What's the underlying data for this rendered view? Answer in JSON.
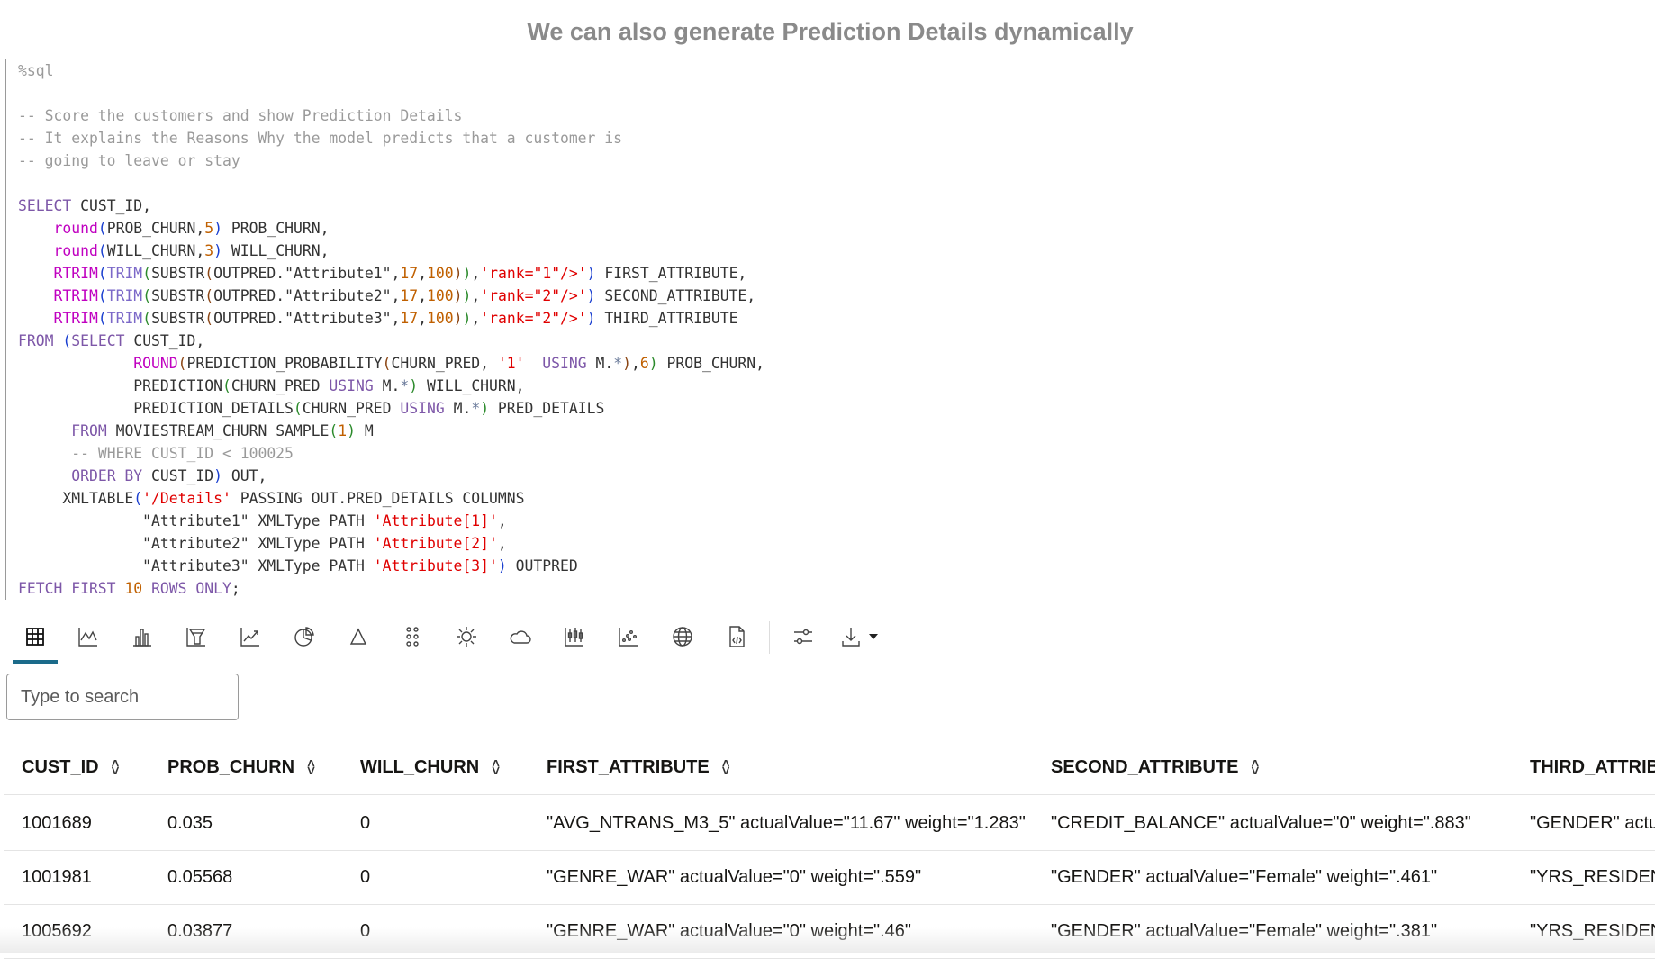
{
  "title": "We can also generate Prediction Details dynamically",
  "code": {
    "lines": [
      [
        [
          "cm",
          "%sql"
        ]
      ],
      [],
      [
        [
          "cm",
          "-- Score the customers and show Prediction Details"
        ]
      ],
      [
        [
          "cm",
          "-- It explains the Reasons Why the model predicts that a customer is"
        ]
      ],
      [
        [
          "cm",
          "-- going to leave or stay"
        ]
      ],
      [],
      [
        [
          "kw",
          "SELECT"
        ],
        [
          "t",
          " CUST_ID,"
        ]
      ],
      [
        [
          "t",
          "    "
        ],
        [
          "fn",
          "round"
        ],
        [
          "p1",
          "("
        ],
        [
          "t",
          "PROB_CHURN,"
        ],
        [
          "nu",
          "5"
        ],
        [
          "p1",
          ")"
        ],
        [
          "t",
          " PROB_CHURN,"
        ]
      ],
      [
        [
          "t",
          "    "
        ],
        [
          "fn",
          "round"
        ],
        [
          "p1",
          "("
        ],
        [
          "t",
          "WILL_CHURN,"
        ],
        [
          "nu",
          "3"
        ],
        [
          "p1",
          ")"
        ],
        [
          "t",
          " WILL_CHURN,"
        ]
      ],
      [
        [
          "t",
          "    "
        ],
        [
          "fn",
          "RTRIM"
        ],
        [
          "p1",
          "("
        ],
        [
          "fn2",
          "TRIM"
        ],
        [
          "p2",
          "("
        ],
        [
          "t",
          "SUBSTR"
        ],
        [
          "p3",
          "("
        ],
        [
          "t",
          "OUTPRED.\"Attribute1\","
        ],
        [
          "nu",
          "17"
        ],
        [
          "t",
          ","
        ],
        [
          "nu",
          "100"
        ],
        [
          "p3",
          ")"
        ],
        [
          "p2",
          ")"
        ],
        [
          "t",
          ","
        ],
        [
          "st",
          "'rank=\"1\"/>'"
        ],
        [
          "p1",
          ")"
        ],
        [
          "t",
          " FIRST_ATTRIBUTE,"
        ]
      ],
      [
        [
          "t",
          "    "
        ],
        [
          "fn",
          "RTRIM"
        ],
        [
          "p1",
          "("
        ],
        [
          "fn2",
          "TRIM"
        ],
        [
          "p2",
          "("
        ],
        [
          "t",
          "SUBSTR"
        ],
        [
          "p3",
          "("
        ],
        [
          "t",
          "OUTPRED.\"Attribute2\","
        ],
        [
          "nu",
          "17"
        ],
        [
          "t",
          ","
        ],
        [
          "nu",
          "100"
        ],
        [
          "p3",
          ")"
        ],
        [
          "p2",
          ")"
        ],
        [
          "t",
          ","
        ],
        [
          "st",
          "'rank=\"2\"/>'"
        ],
        [
          "p1",
          ")"
        ],
        [
          "t",
          " SECOND_ATTRIBUTE,"
        ]
      ],
      [
        [
          "t",
          "    "
        ],
        [
          "fn",
          "RTRIM"
        ],
        [
          "p1",
          "("
        ],
        [
          "fn2",
          "TRIM"
        ],
        [
          "p2",
          "("
        ],
        [
          "t",
          "SUBSTR"
        ],
        [
          "p3",
          "("
        ],
        [
          "t",
          "OUTPRED.\"Attribute3\","
        ],
        [
          "nu",
          "17"
        ],
        [
          "t",
          ","
        ],
        [
          "nu",
          "100"
        ],
        [
          "p3",
          ")"
        ],
        [
          "p2",
          ")"
        ],
        [
          "t",
          ","
        ],
        [
          "st",
          "'rank=\"2\"/>'"
        ],
        [
          "p1",
          ")"
        ],
        [
          "t",
          " THIRD_ATTRIBUTE"
        ]
      ],
      [
        [
          "kw",
          "FROM"
        ],
        [
          "t",
          " "
        ],
        [
          "p1",
          "("
        ],
        [
          "kw",
          "SELECT"
        ],
        [
          "t",
          " CUST_ID,"
        ]
      ],
      [
        [
          "t",
          "             "
        ],
        [
          "fn",
          "ROUND"
        ],
        [
          "p3",
          "("
        ],
        [
          "t",
          "PREDICTION_PROBABILITY"
        ],
        [
          "p3",
          "("
        ],
        [
          "t",
          "CHURN_PRED, "
        ],
        [
          "st",
          "'1'"
        ],
        [
          "t",
          "  "
        ],
        [
          "kw",
          "USING"
        ],
        [
          "t",
          " M."
        ],
        [
          "op",
          "*"
        ],
        [
          "p3",
          ")"
        ],
        [
          "t",
          ","
        ],
        [
          "nu",
          "6"
        ],
        [
          "p2",
          ")"
        ],
        [
          "t",
          " PROB_CHURN,"
        ]
      ],
      [
        [
          "t",
          "             PREDICTION"
        ],
        [
          "p2",
          "("
        ],
        [
          "t",
          "CHURN_PRED "
        ],
        [
          "kw",
          "USING"
        ],
        [
          "t",
          " M."
        ],
        [
          "op",
          "*"
        ],
        [
          "p2",
          ")"
        ],
        [
          "t",
          " WILL_CHURN,"
        ]
      ],
      [
        [
          "t",
          "             PREDICTION_DETAILS"
        ],
        [
          "p2",
          "("
        ],
        [
          "t",
          "CHURN_PRED "
        ],
        [
          "kw",
          "USING"
        ],
        [
          "t",
          " M."
        ],
        [
          "op",
          "*"
        ],
        [
          "p2",
          ")"
        ],
        [
          "t",
          " PRED_DETAILS"
        ]
      ],
      [
        [
          "t",
          "      "
        ],
        [
          "kw",
          "FROM"
        ],
        [
          "t",
          " MOVIESTREAM_CHURN SAMPLE"
        ],
        [
          "p2",
          "("
        ],
        [
          "nu",
          "1"
        ],
        [
          "p2",
          ")"
        ],
        [
          "t",
          " M"
        ]
      ],
      [
        [
          "t",
          "      "
        ],
        [
          "cm",
          "-- WHERE CUST_ID < 100025"
        ]
      ],
      [
        [
          "t",
          "      "
        ],
        [
          "kw",
          "ORDER BY"
        ],
        [
          "t",
          " CUST_ID"
        ],
        [
          "p1",
          ")"
        ],
        [
          "t",
          " OUT,"
        ]
      ],
      [
        [
          "t",
          "     XMLTABLE"
        ],
        [
          "p1",
          "("
        ],
        [
          "st",
          "'/Details'"
        ],
        [
          "t",
          " PASSING OUT.PRED_DETAILS COLUMNS"
        ]
      ],
      [
        [
          "t",
          "              \"Attribute1\" XMLType PATH "
        ],
        [
          "st",
          "'Attribute[1]'"
        ],
        [
          "t",
          ","
        ]
      ],
      [
        [
          "t",
          "              \"Attribute2\" XMLType PATH "
        ],
        [
          "st",
          "'Attribute[2]'"
        ],
        [
          "t",
          ","
        ]
      ],
      [
        [
          "t",
          "              \"Attribute3\" XMLType PATH "
        ],
        [
          "st",
          "'Attribute[3]'"
        ],
        [
          "p1",
          ")"
        ],
        [
          "t",
          " OUTPRED"
        ]
      ],
      [
        [
          "kw",
          "FETCH FIRST"
        ],
        [
          "t",
          " "
        ],
        [
          "nu",
          "10"
        ],
        [
          "t",
          " "
        ],
        [
          "kw",
          "ROWS ONLY"
        ],
        [
          "t",
          ";"
        ]
      ]
    ]
  },
  "toolbar": {
    "icons": [
      "table-icon",
      "line-chart-icon",
      "bar-chart-icon",
      "funnel-icon",
      "trend-icon",
      "pie-chart-icon",
      "pyramid-icon",
      "dots-grid-icon",
      "sun-icon",
      "cloud-icon",
      "boxplot-icon",
      "scatter-icon",
      "globe-icon",
      "code-file-icon",
      "settings-sliders-icon",
      "download-icon"
    ],
    "active": "table-icon",
    "accent": "#1b6b8a"
  },
  "search": {
    "placeholder": "Type to search",
    "value": ""
  },
  "table": {
    "columns": [
      "CUST_ID",
      "PROB_CHURN",
      "WILL_CHURN",
      "FIRST_ATTRIBUTE",
      "SECOND_ATTRIBUTE",
      "THIRD_ATTRIB"
    ],
    "rows": [
      [
        "1001689",
        "0.035",
        "0",
        "\"AVG_NTRANS_M3_5\" actualValue=\"11.67\" weight=\"1.283\"",
        "\"CREDIT_BALANCE\" actualValue=\"0\" weight=\".883\"",
        "\"GENDER\" actu"
      ],
      [
        "1001981",
        "0.05568",
        "0",
        "\"GENRE_WAR\" actualValue=\"0\" weight=\".559\"",
        "\"GENDER\" actualValue=\"Female\" weight=\".461\"",
        "\"YRS_RESIDENC"
      ],
      [
        "1005692",
        "0.03877",
        "0",
        "\"GENRE_WAR\" actualValue=\"0\" weight=\".46\"",
        "\"GENDER\" actualValue=\"Female\" weight=\".381\"",
        "\"YRS_RESIDENC"
      ]
    ]
  }
}
